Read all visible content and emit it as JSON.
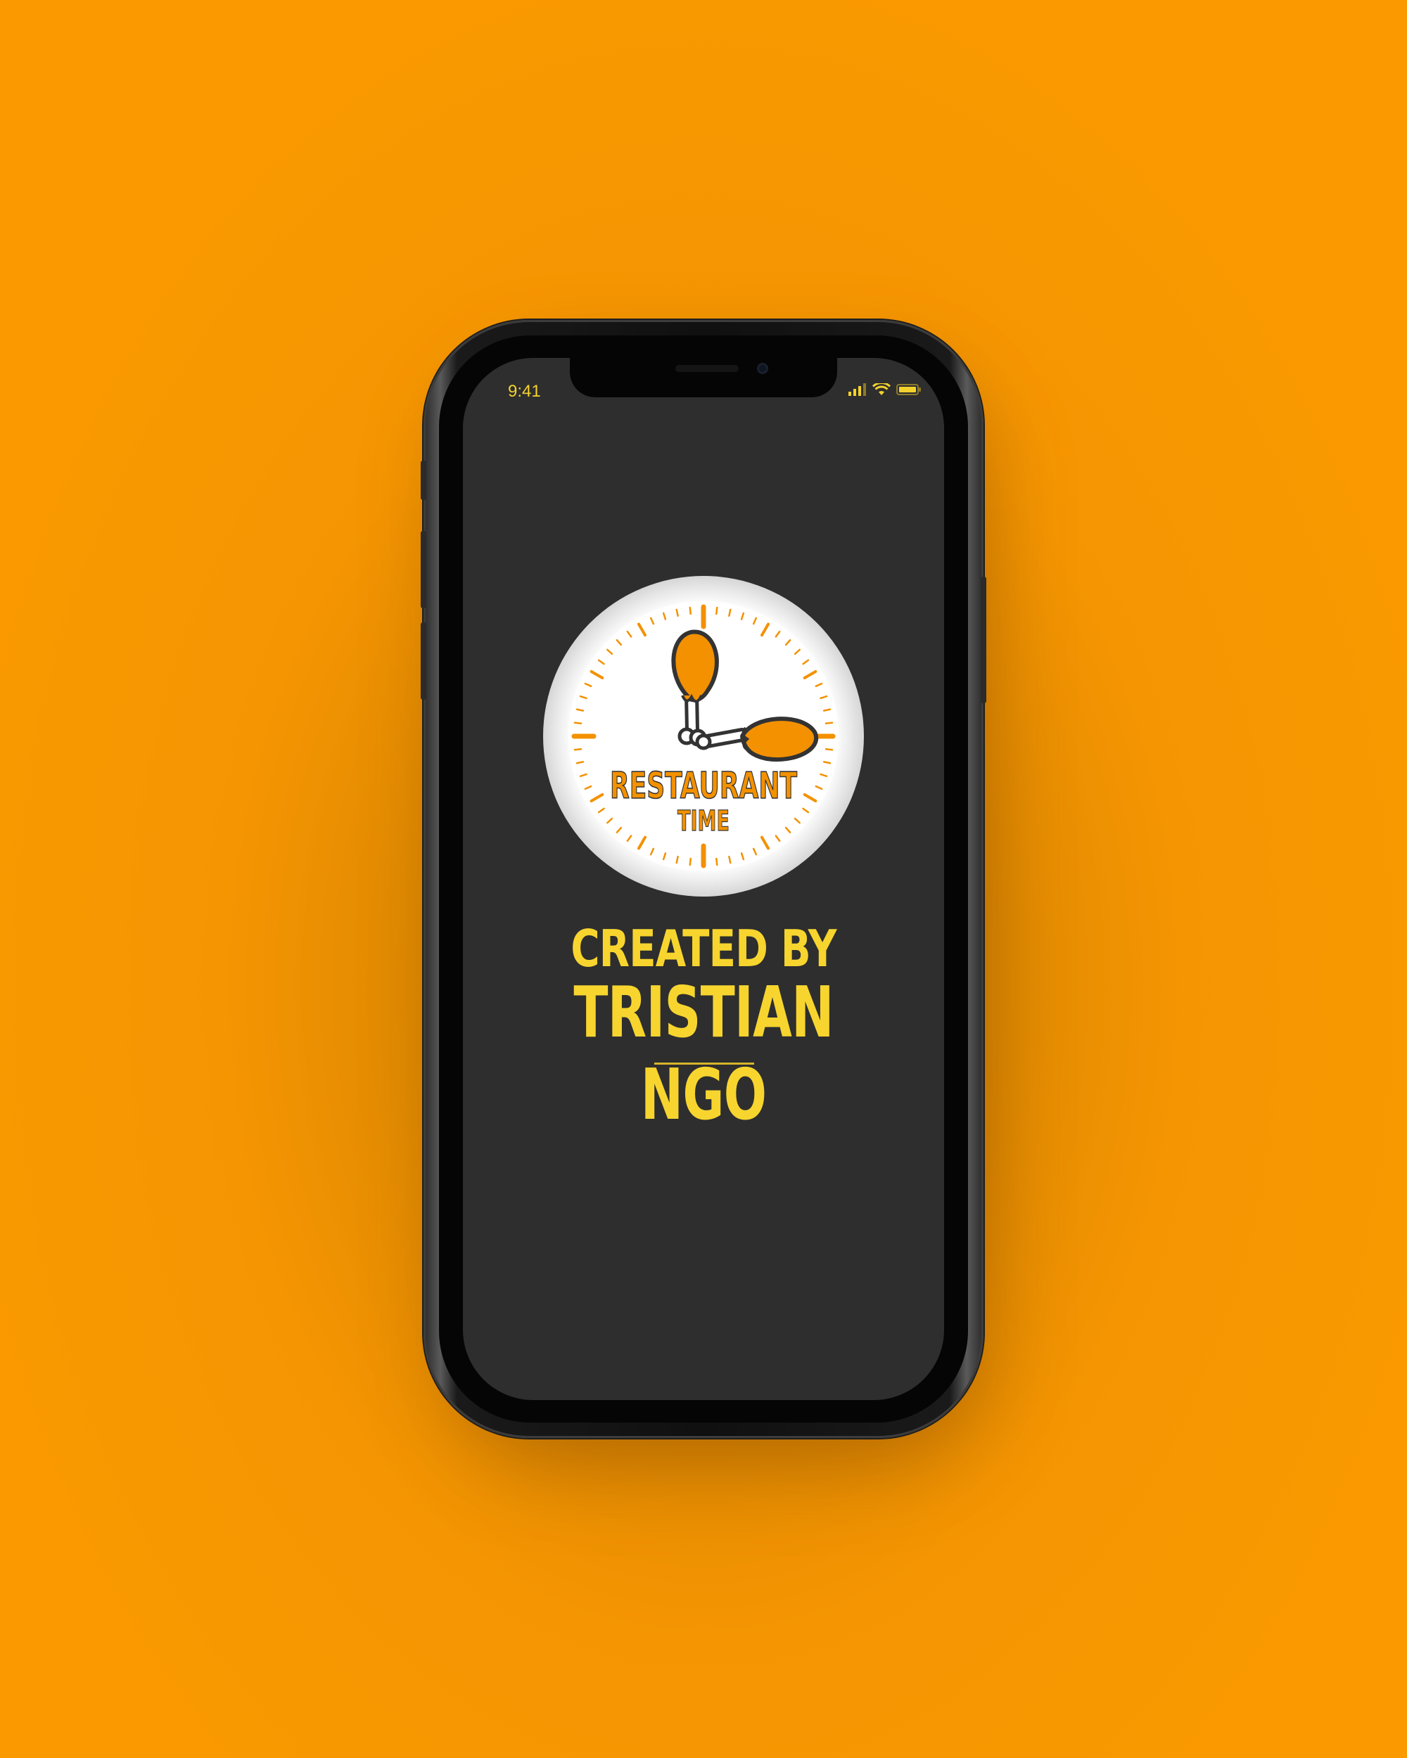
{
  "status_bar": {
    "time": "9:41",
    "signal_icon": "cellular-signal-icon",
    "wifi_icon": "wifi-icon",
    "battery_icon": "battery-icon"
  },
  "logo": {
    "line1": "RESTAURANT",
    "line2": "TIME",
    "icon": "chicken-drumstick-clock-icon"
  },
  "credits": {
    "heading": "CREATED BY",
    "author": "TRISTIAN NGO"
  },
  "colors": {
    "background": "#fa9a00",
    "screen": "#2e2e2e",
    "text_yellow": "#f7d52e",
    "logo_orange": "#f39100",
    "logo_outline": "#333333"
  }
}
